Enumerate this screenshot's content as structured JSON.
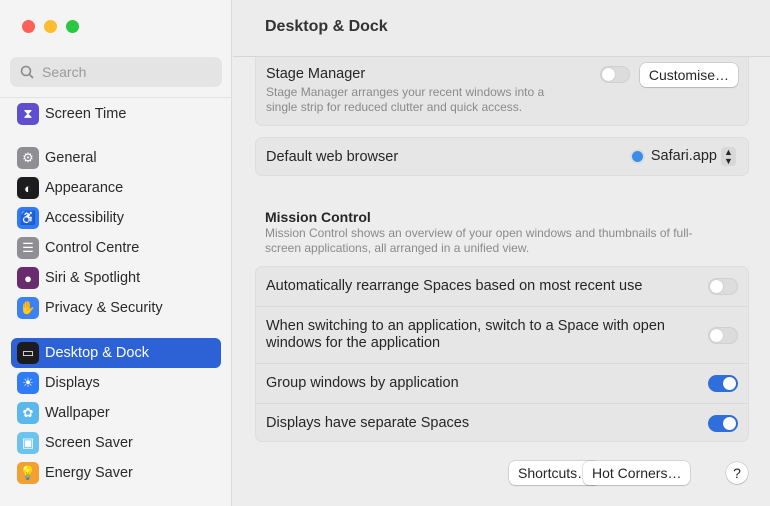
{
  "window": {
    "title": "Desktop & Dock"
  },
  "sidebar": {
    "search_placeholder": "Search",
    "items": [
      {
        "label": "Screen Time",
        "icon": "hourglass-icon",
        "color": "#5e4fd1"
      },
      {
        "label": "General",
        "icon": "gear-icon",
        "color": "#8e8e93"
      },
      {
        "label": "Appearance",
        "icon": "appearance-icon",
        "color": "#1c1c1e"
      },
      {
        "label": "Accessibility",
        "icon": "accessibility-icon",
        "color": "#2f7cf6"
      },
      {
        "label": "Control Centre",
        "icon": "switches-icon",
        "color": "#8e8e93"
      },
      {
        "label": "Siri & Spotlight",
        "icon": "siri-icon",
        "color": "#6a2a6e"
      },
      {
        "label": "Privacy & Security",
        "icon": "hand-icon",
        "color": "#3b82f6"
      },
      {
        "label": "Desktop & Dock",
        "icon": "dock-icon",
        "color": "#1c1c1e",
        "selected": true
      },
      {
        "label": "Displays",
        "icon": "sun-icon",
        "color": "#2f7cf6"
      },
      {
        "label": "Wallpaper",
        "icon": "flower-icon",
        "color": "#5ab8ec"
      },
      {
        "label": "Screen Saver",
        "icon": "screensaver-icon",
        "color": "#6cc3ee"
      },
      {
        "label": "Energy Saver",
        "icon": "bulb-icon",
        "color": "#f2a033"
      }
    ]
  },
  "stage_manager": {
    "label": "Stage Manager",
    "description_line1": "Stage Manager arranges your recent windows into a",
    "description_line2": "single strip for reduced clutter and quick access.",
    "enabled": false,
    "button": "Customise…"
  },
  "browser": {
    "label": "Default web browser",
    "value": "Safari.app"
  },
  "mission_control": {
    "heading": "Mission Control",
    "description_line1": "Mission Control shows an overview of your open windows and thumbnails of full-",
    "description_line2": "screen applications, all arranged in a unified view.",
    "options": [
      {
        "label": "Automatically rearrange Spaces based on most recent use",
        "enabled": false
      },
      {
        "label_line1": "When switching to an application, switch to a Space with open",
        "label_line2": "windows for the application",
        "enabled": false
      },
      {
        "label": "Group windows by application",
        "enabled": true
      },
      {
        "label": "Displays have separate Spaces",
        "enabled": true
      }
    ]
  },
  "footer": {
    "shortcuts": "Shortcuts…",
    "hot_corners": "Hot Corners…",
    "help": "?"
  }
}
